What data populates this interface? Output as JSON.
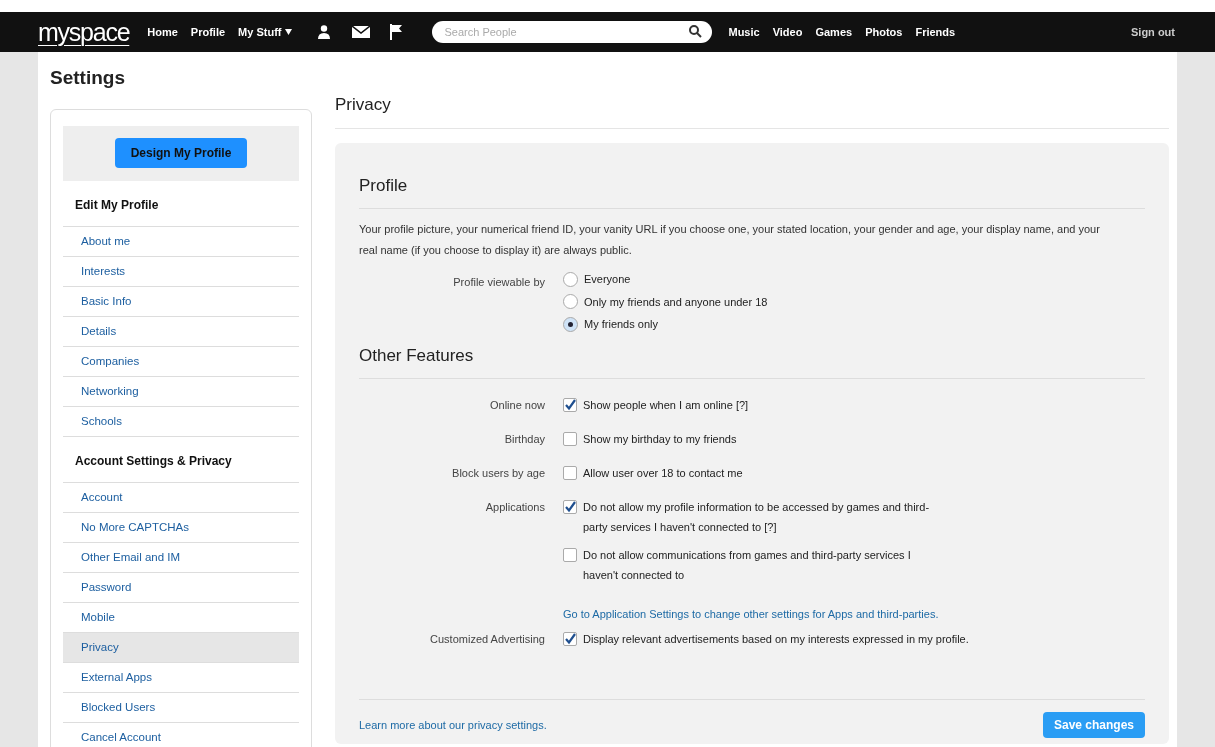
{
  "nav": {
    "logo": "myspace",
    "links_left": [
      {
        "label": "Home",
        "dropdown": false
      },
      {
        "label": "Profile",
        "dropdown": false
      },
      {
        "label": "My Stuff",
        "dropdown": true
      }
    ],
    "search": {
      "placeholder": "Search People"
    },
    "links_right": [
      "Music",
      "Video",
      "Games",
      "Photos",
      "Friends"
    ],
    "sign_out": "Sign out"
  },
  "page_title": "Settings",
  "sidebar": {
    "design_button": "Design My Profile",
    "sections": [
      {
        "heading": "Edit My Profile",
        "items": [
          {
            "label": "About me",
            "selected": false
          },
          {
            "label": "Interests",
            "selected": false
          },
          {
            "label": "Basic Info",
            "selected": false
          },
          {
            "label": "Details",
            "selected": false
          },
          {
            "label": "Companies",
            "selected": false
          },
          {
            "label": "Networking",
            "selected": false
          },
          {
            "label": "Schools",
            "selected": false
          }
        ]
      },
      {
        "heading": "Account Settings & Privacy",
        "items": [
          {
            "label": "Account",
            "selected": false
          },
          {
            "label": "No More CAPTCHAs",
            "selected": false
          },
          {
            "label": "Other Email and IM",
            "selected": false
          },
          {
            "label": "Password",
            "selected": false
          },
          {
            "label": "Mobile",
            "selected": false
          },
          {
            "label": "Privacy",
            "selected": true
          },
          {
            "label": "External Apps",
            "selected": false
          },
          {
            "label": "Blocked Users",
            "selected": false
          },
          {
            "label": "Cancel Account",
            "selected": false
          }
        ]
      }
    ]
  },
  "main": {
    "title": "Privacy",
    "profile": {
      "heading": "Profile",
      "description": "Your profile picture, your numerical friend ID, your vanity URL if you choose one, your stated location, your gender and age, your display name, and your real name (if you choose to display it) are always public.",
      "viewable_label": "Profile viewable by",
      "options": [
        {
          "label": "Everyone",
          "selected": false
        },
        {
          "label": "Only my friends and anyone under 18",
          "selected": false
        },
        {
          "label": "My friends only",
          "selected": true
        }
      ]
    },
    "other": {
      "heading": "Other Features",
      "rows": [
        {
          "kind": "single",
          "label": "Online now",
          "options": [
            {
              "text": "Show people when I am online [?]",
              "checked": true
            }
          ]
        },
        {
          "kind": "single",
          "label": "Birthday",
          "options": [
            {
              "text": "Show my birthday to my friends",
              "checked": false
            }
          ]
        },
        {
          "kind": "single",
          "label": "Block users by age",
          "options": [
            {
              "text": "Allow user over 18 to contact me",
              "checked": false
            }
          ]
        },
        {
          "kind": "group",
          "label": "Applications",
          "options": [
            {
              "text": "Do not allow my profile information to be accessed by games and third-party services I haven't connected to [?]",
              "checked": true
            },
            {
              "text": "Do not allow communications from games and third-party services I haven't connected to",
              "checked": false
            }
          ],
          "link": "Go to Application Settings to change other settings for Apps and third-parties."
        },
        {
          "kind": "single",
          "label": "Customized Advertising",
          "options": [
            {
              "text": "Display relevant advertisements based on my interests expressed in my profile.",
              "checked": true
            }
          ]
        }
      ]
    },
    "footer_link": "Learn more about our privacy settings.",
    "save_button": "Save changes"
  }
}
